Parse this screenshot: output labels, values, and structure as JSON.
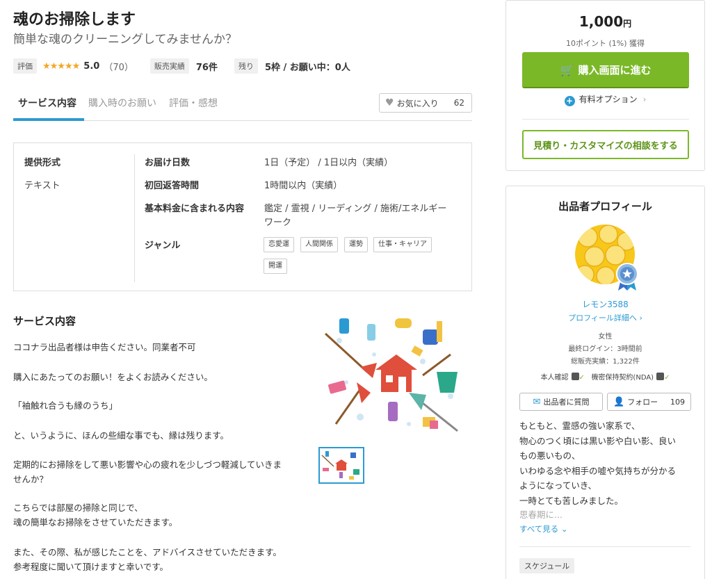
{
  "service": {
    "title": "魂のお掃除します",
    "subtitle": "簡単な魂のクリーニングしてみませんか？",
    "rating_label": "評価",
    "stars": "★★★★★",
    "rating": "5.0",
    "rating_count": "（70）",
    "sales_label": "販売実績",
    "sales_value": "76件",
    "remaining_label": "残り",
    "remaining_value": "5枠 / お願い中：0人"
  },
  "tabs": [
    {
      "label": "サービス内容",
      "active": true
    },
    {
      "label": "購入時のお願い",
      "active": false
    },
    {
      "label": "評価・感想",
      "active": false
    }
  ],
  "favorite": {
    "label": "お気に入り",
    "count": "62"
  },
  "spec": {
    "format_label": "提供形式",
    "format_value": "テキスト",
    "delivery_label": "お届け日数",
    "delivery_value": "1日（予定） / 1日以内（実績）",
    "first_reply_label": "初回返答時間",
    "first_reply_value": "1時間以内（実績）",
    "included_label": "基本料金に含まれる内容",
    "included_value_1": "鑑定 / 霊視 / リーディング / 施術/エネルギー",
    "included_value_2": "ワーク",
    "genre_label": "ジャンル",
    "genres": [
      "恋愛運",
      "人間関係",
      "運勢",
      "仕事・キャリア",
      "開運"
    ]
  },
  "description": {
    "heading": "サービス内容",
    "lines": [
      "ココナラ出品者様は申告ください。同業者不可",
      "購入にあたってのお願い！をよくお読みください。",
      "「袖触れ合うも縁のうち」",
      "と、いうように、ほんの些細な事でも、縁は残ります。",
      "定期的にお掃除をして悪い影響や心の疲れを少しづつ軽減していきま",
      "せんか？",
      "こちらでは部屋の掃除と同じで、",
      "魂の簡単なお掃除をさせていただきます。",
      "また、その際、私が感じたことを、アドバイスさせていただきます。",
      "参考程度に聞いて頂けますと幸いです。"
    ]
  },
  "purchase": {
    "price": "1,000",
    "price_unit": "円",
    "points": "10ポイント (1%) 獲得",
    "buy_label": "購入画面に進む",
    "option_label": "有料オプション",
    "consult_label": "見積り・カスタマイズの相談をする"
  },
  "profile": {
    "title": "出品者プロフィール",
    "name": "レモン3588",
    "detail_link": "プロフィール詳細へ",
    "gender": "女性",
    "last_login": "最終ログイン：3時間前",
    "total_sales": "総販売実績：1,322件",
    "identity": "本人確認",
    "nda": "機密保持契約(NDA)",
    "question_label": "出品者に質問",
    "follow_label": "フォロー",
    "follow_count": "109",
    "bio": [
      "もともと、霊感の強い家系で、",
      "物心のつく頃には黒い影や白い影、良い",
      "もの悪いもの、",
      "いわゆる念や相手の嘘や気持ちが分かる",
      "ようになっていき、",
      "一時とても苦しみました。",
      "思春期に..."
    ],
    "show_more": "すべて見る",
    "schedule_label": "スケジュール"
  },
  "colors": {
    "accent": "#2b9ad3",
    "buy": "#7ab827",
    "star": "#f5a623"
  }
}
